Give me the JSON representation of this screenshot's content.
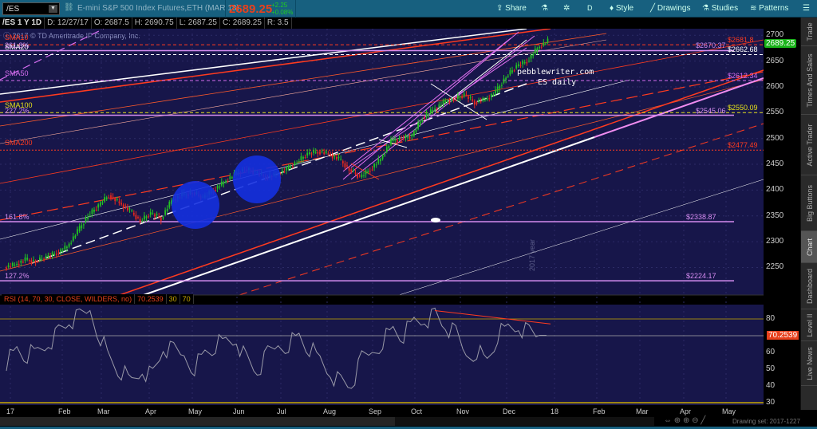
{
  "toolbar": {
    "symbol": "/ES",
    "description": "E-mini S&P 500 Index Futures,ETH (MAR 18)",
    "last": "2689.25",
    "change": "+2.25",
    "change_pct": "+0.08%",
    "share": "Share",
    "aggregation": "D",
    "style": "Style",
    "drawings": "Drawings",
    "studies": "Studies",
    "patterns": "Patterns"
  },
  "infobar": {
    "title": "/ES 1 Y 1D",
    "date": "D: 12/27/17",
    "open": "O: 2687.5",
    "high": "H: 2690.75",
    "low": "L: 2687.25",
    "close": "C: 2689.25",
    "range": "R: 3.5"
  },
  "copyright": "2017 © TD Ameritrade IP Company, Inc.",
  "sma_labels": [
    {
      "text": "SMA10",
      "price": 2681.8,
      "color": "#ff3b1f"
    },
    {
      "text": "SMA20",
      "price": 2662.68,
      "color": "#ffffff"
    },
    {
      "text": "SMA50",
      "price": 2612.34,
      "color": "#d66ef0"
    },
    {
      "text": "SMA100",
      "price": 2550.09,
      "color": "#e6e21a"
    },
    {
      "text": "SMA200",
      "price": 2477.49,
      "color": "#ff3b1f"
    }
  ],
  "fib_labels": [
    {
      "text": "261.8%",
      "price": 2670.37
    },
    {
      "text": "227.2%",
      "price": 2545.06
    },
    {
      "text": "161.8%",
      "price": 2338.87
    },
    {
      "text": "127.2%",
      "price": 2224.17
    }
  ],
  "levels": [
    {
      "label": "$2681.8",
      "price": 2681.8,
      "color": "#ff3b1f",
      "style": "dashed"
    },
    {
      "label": "$2670.37",
      "price": 2670.37,
      "color": "#d58cf0",
      "style": "solid"
    },
    {
      "label": "$2662.68",
      "price": 2662.68,
      "color": "#ffffff",
      "style": "dashed"
    },
    {
      "label": "$2612.34",
      "price": 2612.34,
      "color": "#d66ef0",
      "style": "dashed"
    },
    {
      "label": "$2550.09",
      "price": 2550.09,
      "color": "#e6e21a",
      "style": "dashed"
    },
    {
      "label": "$2545.06",
      "price": 2545.06,
      "color": "#d58cf0",
      "style": "solid"
    },
    {
      "label": "$2477.49",
      "price": 2477.49,
      "color": "#ff3b1f",
      "style": "dotted"
    },
    {
      "label": "$2338.87",
      "price": 2338.87,
      "color": "#d58cf0",
      "style": "solid"
    },
    {
      "label": "$2224.17",
      "price": 2224.17,
      "color": "#d58cf0",
      "style": "solid"
    }
  ],
  "annotation": {
    "line1": "pebblewriter.com",
    "line2": "ES daily",
    "year_marker": "2017 year"
  },
  "rsi": {
    "header": "RSI (14, 70, 30, CLOSE, WILDERS, no)",
    "value": "70.2539",
    "os": "30",
    "ob": "70"
  },
  "sidebar": [
    "Trade",
    "Times And Sales",
    "Active Trader",
    "Big Buttons",
    "Chart",
    "Dashboard",
    "Level II",
    "Live News"
  ],
  "bottom": {
    "drawing_set": "Drawing set: 2017-1227"
  },
  "chart_data": {
    "type": "candlestick",
    "title": "/ES 1 Y 1D",
    "x_tick_labels": [
      "17",
      "Feb",
      "Mar",
      "Apr",
      "May",
      "Jun",
      "Jul",
      "Aug",
      "Sep",
      "Oct",
      "Nov",
      "Dec",
      "18",
      "Feb",
      "Mar",
      "Apr",
      "May"
    ],
    "y_ticks": [
      2250,
      2300,
      2350,
      2400,
      2450,
      2500,
      2550,
      2600,
      2650,
      2700
    ],
    "ylim": [
      2200,
      2715
    ],
    "weekly_close": [
      2255,
      2265,
      2262,
      2270,
      2278,
      2290,
      2320,
      2350,
      2370,
      2390,
      2375,
      2360,
      2340,
      2355,
      2345,
      2380,
      2390,
      2395,
      2385,
      2400,
      2415,
      2430,
      2440,
      2435,
      2425,
      2430,
      2440,
      2455,
      2470,
      2475,
      2470,
      2460,
      2440,
      2425,
      2440,
      2460,
      2495,
      2500,
      2505,
      2540,
      2555,
      2570,
      2575,
      2585,
      2570,
      2575,
      2590,
      2620,
      2640,
      2650,
      2675,
      2689
    ],
    "rsi_ticks": [
      30,
      40,
      50,
      60,
      70,
      80
    ],
    "rsi_ylim": [
      28,
      90
    ],
    "rsi_values": [
      55,
      62,
      58,
      60,
      66,
      72,
      78,
      80,
      85,
      70,
      55,
      48,
      42,
      50,
      46,
      62,
      60,
      58,
      52,
      60,
      64,
      66,
      68,
      55,
      48,
      58,
      64,
      66,
      70,
      62,
      55,
      48,
      42,
      40,
      55,
      60,
      68,
      74,
      70,
      78,
      80,
      82,
      75,
      70,
      58,
      62,
      55,
      70,
      74,
      76,
      72,
      70.25
    ]
  }
}
